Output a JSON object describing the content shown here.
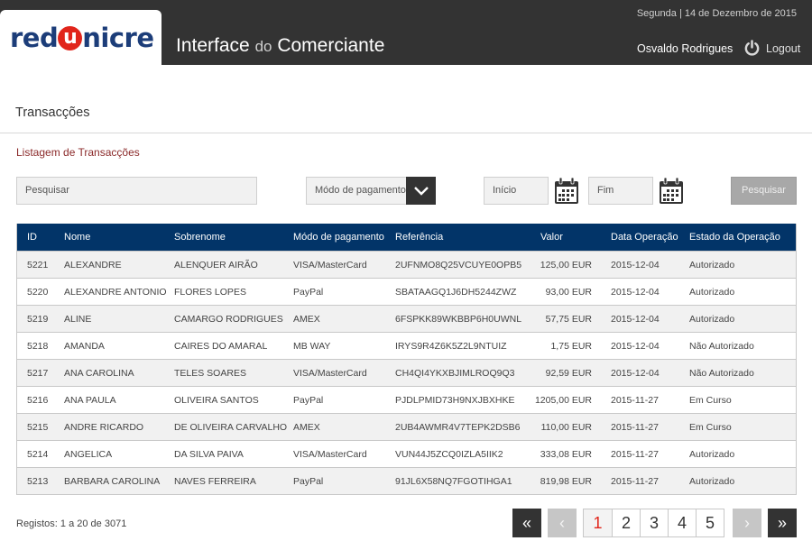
{
  "header": {
    "logo": {
      "prefix": "red",
      "u": "u",
      "suffix": "nicre"
    },
    "title_main": "Interface ",
    "title_do": "do",
    "title_end": " Comerciante",
    "date": "Segunda | 14 de Dezembro de 2015",
    "user": "Osvaldo Rodrigues",
    "logout_label": "Logout"
  },
  "page": {
    "title": "Transacções",
    "section_title": "Listagem de Transacções"
  },
  "filters": {
    "search_placeholder": "Pesquisar",
    "payment_mode": "Módo de pagamento",
    "start_placeholder": "Início",
    "end_placeholder": "Fim",
    "search_button": "Pesquisar"
  },
  "table": {
    "columns": [
      "ID",
      "Nome",
      "Sobrenome",
      "Módo de pagamento",
      "Referência",
      "Valor",
      "Data Operação",
      "Estado da Operação"
    ],
    "rows": [
      {
        "id": "5221",
        "nome": "ALEXANDRE",
        "sobrenome": "ALENQUER AIRÃO",
        "modo": "VISA/MasterCard",
        "ref": "2UFNMO8Q25VCUYE0OPB5",
        "valor": "125,00 EUR",
        "data": "2015-12-04",
        "estado": "Autorizado"
      },
      {
        "id": "5220",
        "nome": "ALEXANDRE ANTONIO",
        "sobrenome": "FLORES LOPES",
        "modo": "PayPal",
        "ref": "SBATAAGQ1J6DH5244ZWZ",
        "valor": "93,00 EUR",
        "data": "2015-12-04",
        "estado": "Autorizado"
      },
      {
        "id": "5219",
        "nome": "ALINE",
        "sobrenome": "CAMARGO RODRIGUES",
        "modo": "AMEX",
        "ref": "6FSPKK89WKBBP6H0UWNL",
        "valor": "57,75 EUR",
        "data": "2015-12-04",
        "estado": "Autorizado"
      },
      {
        "id": "5218",
        "nome": "AMANDA",
        "sobrenome": "CAIRES DO AMARAL",
        "modo": "MB WAY",
        "ref": "IRYS9R4Z6K5Z2L9NTUIZ",
        "valor": "1,75 EUR",
        "data": "2015-12-04",
        "estado": "Não Autorizado"
      },
      {
        "id": "5217",
        "nome": "ANA CAROLINA",
        "sobrenome": "TELES SOARES",
        "modo": "VISA/MasterCard",
        "ref": "CH4QI4YKXBJIMLROQ9Q3",
        "valor": "92,59 EUR",
        "data": "2015-12-04",
        "estado": "Não Autorizado"
      },
      {
        "id": "5216",
        "nome": "ANA PAULA",
        "sobrenome": "OLIVEIRA SANTOS",
        "modo": "PayPal",
        "ref": "PJDLPMID73H9NXJBXHKE",
        "valor": "1205,00 EUR",
        "data": "2015-11-27",
        "estado": "Em Curso"
      },
      {
        "id": "5215",
        "nome": "ANDRE RICARDO",
        "sobrenome": "DE OLIVEIRA CARVALHO",
        "modo": "AMEX",
        "ref": "2UB4AWMR4V7TEPK2DSB6",
        "valor": "110,00 EUR",
        "data": "2015-11-27",
        "estado": "Em Curso"
      },
      {
        "id": "5214",
        "nome": "ANGELICA",
        "sobrenome": "DA SILVA PAIVA",
        "modo": "VISA/MasterCard",
        "ref": "VUN44J5ZCQ0IZLA5IIK2",
        "valor": "333,08 EUR",
        "data": "2015-11-27",
        "estado": "Autorizado"
      },
      {
        "id": "5213",
        "nome": "BARBARA CAROLINA",
        "sobrenome": "NAVES FERREIRA",
        "modo": "PayPal",
        "ref": "91JL6X58NQ7FGOTIHGA1",
        "valor": "819,98 EUR",
        "data": "2015-11-27",
        "estado": "Autorizado"
      }
    ]
  },
  "footer": {
    "records": "Registos: 1 a 20 de 3071",
    "first": "«",
    "prev": "‹",
    "pages": [
      "1",
      "2",
      "3",
      "4",
      "5"
    ],
    "current_page": "1",
    "next": "›",
    "last": "»"
  },
  "colors": {
    "header_bg": "#333333",
    "brand_blue": "#1c3d79",
    "brand_red": "#e1251b",
    "table_header": "#023468",
    "section_title": "#8b2a2a"
  }
}
